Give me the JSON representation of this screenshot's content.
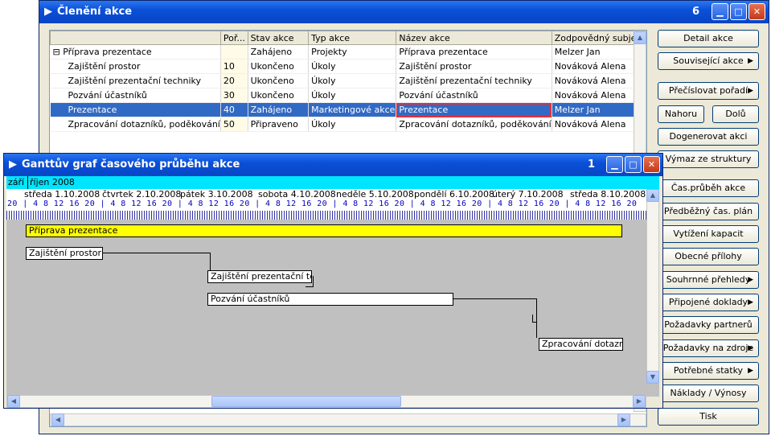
{
  "main_window": {
    "title": "Členění akce",
    "number": "6",
    "columns": [
      "",
      "Poř...",
      "Stav akce",
      "Typ akce",
      "Název akce",
      "Zodpovědný subjekt"
    ],
    "rows": [
      {
        "name": "Příprava prezentace",
        "order": "",
        "status": "Zahájeno",
        "type": "Projekty",
        "title": "Příprava prezentace",
        "owner": "Melzer Jan",
        "expander": "⊟"
      },
      {
        "name": "Zajištění prostor",
        "order": "10",
        "status": "Ukončeno",
        "type": "Úkoly",
        "title": "Zajištění prostor",
        "owner": "Nováková Alena"
      },
      {
        "name": "Zajištění prezentační techniky",
        "order": "20",
        "status": "Ukončeno",
        "type": "Úkoly",
        "title": "Zajištění prezentační techniky",
        "owner": "Nováková Alena"
      },
      {
        "name": "Pozvání účastníků",
        "order": "30",
        "status": "Ukončeno",
        "type": "Úkoly",
        "title": "Pozvání účastníků",
        "owner": "Nováková Alena"
      },
      {
        "name": "Prezentace",
        "order": "40",
        "status": "Zahájeno",
        "type": "Marketingové akce",
        "title": "Prezentace",
        "owner": "Melzer Jan"
      },
      {
        "name": "Zpracování dotazníků, poděkování",
        "order": "50",
        "status": "Připraveno",
        "type": "Úkoly",
        "title": "Zpracování dotazníků, poděkování",
        "owner": "Nováková Alena"
      }
    ],
    "selected_row": 4
  },
  "buttons": {
    "detail": "Detail akce",
    "related": "Související akce",
    "renumber": "Přečíslovat pořadí",
    "up": "Nahoru",
    "down": "Dolů",
    "generate": "Dogenerovat akci",
    "remove": "Výmaz ze struktury",
    "timeline": "Čas.průběh akce",
    "prelim": "Předběžný čas. plán",
    "capacity": "Vytížení kapacit",
    "attachments": "Obecné přílohy",
    "summary": "Souhrnné přehledy",
    "docs": "Připojené doklady",
    "partners": "Požadavky partnerů",
    "resources": "Požadavky na zdroje",
    "goods": "Potřebné statky",
    "costs": "Náklady / Výnosy",
    "print": "Tisk"
  },
  "gantt_window": {
    "title": "Ganttův graf časového průběhu akce",
    "number": "1",
    "months": [
      "září",
      "říjen 2008"
    ],
    "days": [
      "středa 1.10.2008",
      "čtvrtek 2.10.2008",
      "pátek 3.10.2008",
      "sobota 4.10.2008",
      "neděle 5.10.2008",
      "pondělí 6.10.2008",
      "úterý 7.10.2008",
      "středa 8.10.2008"
    ],
    "hours_row": "20 |  4   8  12 16 20 |  4   8  12 16 20 |  4   8  12 16 20 |  4   8  12 16 20 |  4   8  12 16 20 |  4   8  12 16 20 |  4   8  12 16 20 |  4   8  12 16 20",
    "bars": [
      "Příprava prezentace",
      "Zajištění prostor",
      "Zajištění prezentační tech",
      "Pozvání účastníků",
      "Zpracování dotazníků"
    ]
  },
  "colors": {
    "title_blue": "#0b50d8",
    "selected": "#316ac5",
    "gantt_band": "#00e5ff",
    "summary_bar": "#ffff00"
  }
}
